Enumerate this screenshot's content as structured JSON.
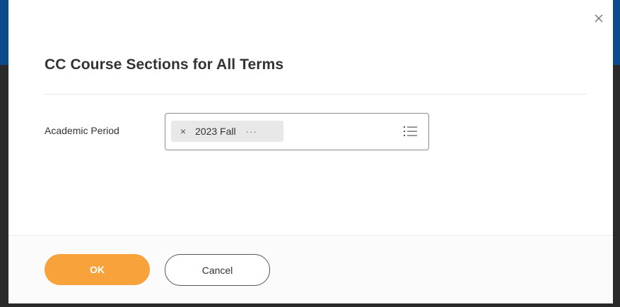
{
  "dialog": {
    "title": "CC Course Sections for All Terms",
    "close_icon": "close-icon"
  },
  "form": {
    "academic_period": {
      "label": "Academic Period",
      "selected": [
        {
          "value": "2023 Fall",
          "remove_icon": "x-icon",
          "more": "···"
        }
      ],
      "list_icon": "list-icon"
    }
  },
  "footer": {
    "ok_label": "OK",
    "cancel_label": "Cancel"
  },
  "colors": {
    "ok_button": "#f7a23b",
    "header_bar": "#0b4a8b"
  }
}
